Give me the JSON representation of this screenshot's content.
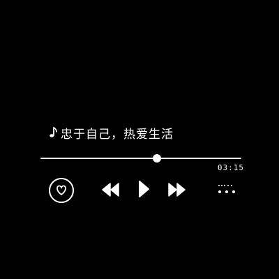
{
  "player": {
    "song_title": "忠于自己，热爱生活",
    "time": "03:15",
    "progress": 0.58,
    "accent_color": "#ffffff",
    "background_color": "#000000"
  },
  "controls": {
    "like_icon": "heart-in-circle-icon",
    "prev_icon": "rewind-icon",
    "play_icon": "play-icon",
    "next_icon": "fast-forward-icon",
    "more_icon": "more-dots-icon",
    "note_icon": "music-note-icon"
  }
}
